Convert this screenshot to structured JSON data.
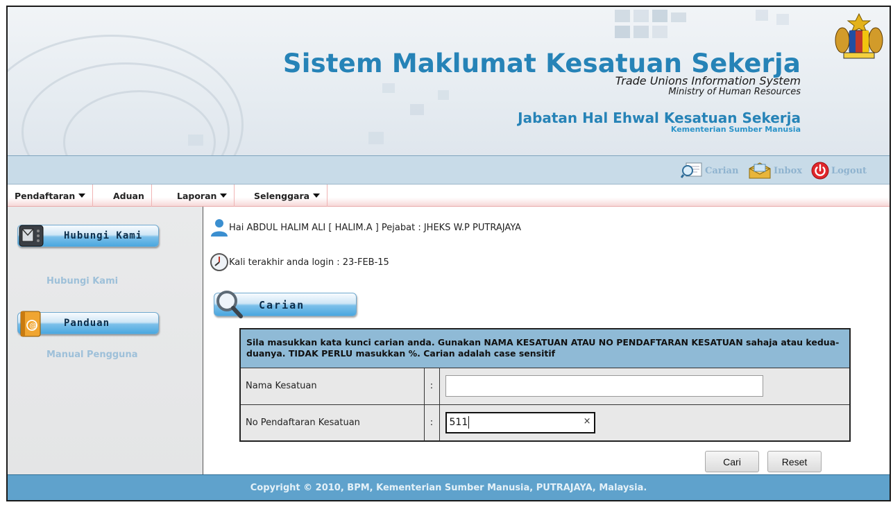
{
  "header": {
    "title": "Sistem Maklumat Kesatuan Sekerja",
    "subtitle_en": "Trade Unions Information System",
    "ministry_en": "Ministry of Human Resources",
    "department": "Jabatan Hal Ehwal Kesatuan Sekerja",
    "ministry_ms": "Kementerian Sumber Manusia"
  },
  "toolbar": {
    "carian": "Carian",
    "inbox": "Inbox",
    "logout": "Logout"
  },
  "menu": {
    "items": [
      {
        "label": "Pendaftaran",
        "dropdown": true
      },
      {
        "label": "Aduan",
        "dropdown": false
      },
      {
        "label": "Laporan",
        "dropdown": true
      },
      {
        "label": "Selenggara",
        "dropdown": true
      }
    ]
  },
  "sidebar": {
    "contact_button": "Hubungi Kami",
    "contact_link": "Hubungi Kami",
    "guide_button": "Panduan",
    "guide_link": "Manual Pengguna"
  },
  "main": {
    "greeting": "Hai ABDUL HALIM ALI [ HALIM.A ] Pejabat : JHEKS W.P PUTRAJAYA",
    "last_login": "Kali terakhir anda login : 23-FEB-15",
    "search_button": "Carian",
    "instructions": "Sila masukkan kata kunci carian anda. Gunakan NAMA KESATUAN ATAU NO PENDAFTARAN KESATUAN sahaja atau kedua-duanya. TIDAK PERLU masukkan %. Carian adalah case sensitif",
    "colon": ":",
    "fields": {
      "nama_label": "Nama Kesatuan",
      "nama_value": "",
      "no_label": "No Pendaftaran Kesatuan",
      "no_value": "511",
      "clear_glyph": "×"
    },
    "buttons": {
      "cari": "Cari",
      "reset": "Reset"
    }
  },
  "footer": {
    "copyright": "Copyright © 2010, BPM, Kementerian Sumber Manusia, PUTRAJAYA, Malaysia."
  },
  "colors": {
    "brand_blue": "#2683b7",
    "toolbar_bg": "#c8dbe8",
    "footer_bg": "#5fa2cc",
    "table_header": "#8fbad6",
    "sidebar_link": "#9ec0d9"
  },
  "icons": [
    "carian-icon",
    "inbox-icon",
    "logout-icon",
    "user-icon",
    "clock-icon",
    "magnifier-icon",
    "contact-icon",
    "guide-icon",
    "crest-icon"
  ]
}
